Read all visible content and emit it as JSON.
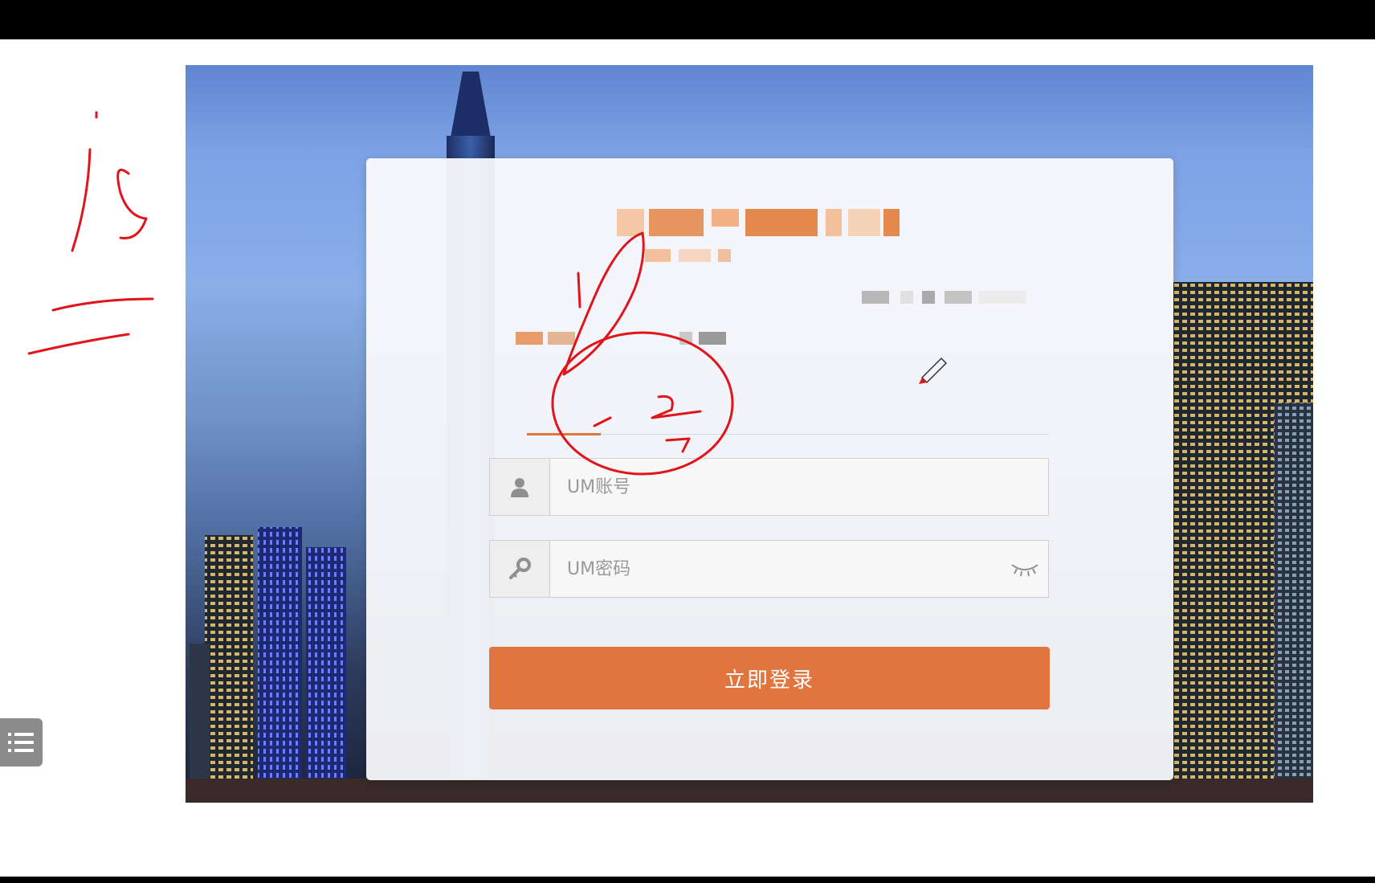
{
  "login": {
    "username_placeholder": "UM账号",
    "password_placeholder": "UM密码",
    "submit_label": "立即登录"
  },
  "icons": {
    "user": "user-icon",
    "key": "key-icon",
    "eye": "eye-closed-icon",
    "list": "list-icon"
  },
  "colors": {
    "accent": "#e07540",
    "annotation": "#e0151b",
    "top_bar": "#000000"
  }
}
